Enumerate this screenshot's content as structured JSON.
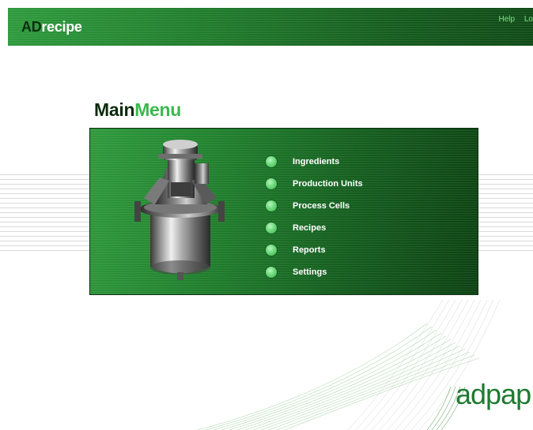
{
  "header": {
    "logo_prefix": "AD",
    "logo_suffix": "recipe",
    "links": [
      "Help",
      "Lo"
    ]
  },
  "page": {
    "title_part1": "Main",
    "title_part2": "Menu"
  },
  "menu": {
    "items": [
      {
        "label": "Ingredients",
        "icon": "green-dot-icon"
      },
      {
        "label": "Production Units",
        "icon": "green-dot-icon"
      },
      {
        "label": "Process Cells",
        "icon": "green-dot-icon"
      },
      {
        "label": "Recipes",
        "icon": "green-dot-icon"
      },
      {
        "label": "Reports",
        "icon": "green-dot-icon"
      },
      {
        "label": "Settings",
        "icon": "green-dot-icon"
      }
    ]
  },
  "brand": {
    "name": "adpap"
  },
  "colors": {
    "header_green": "#1f7a2b",
    "accent_green": "#3cb84e",
    "dark_green": "#0a2a0c",
    "dot_green": "#6fd97d"
  }
}
